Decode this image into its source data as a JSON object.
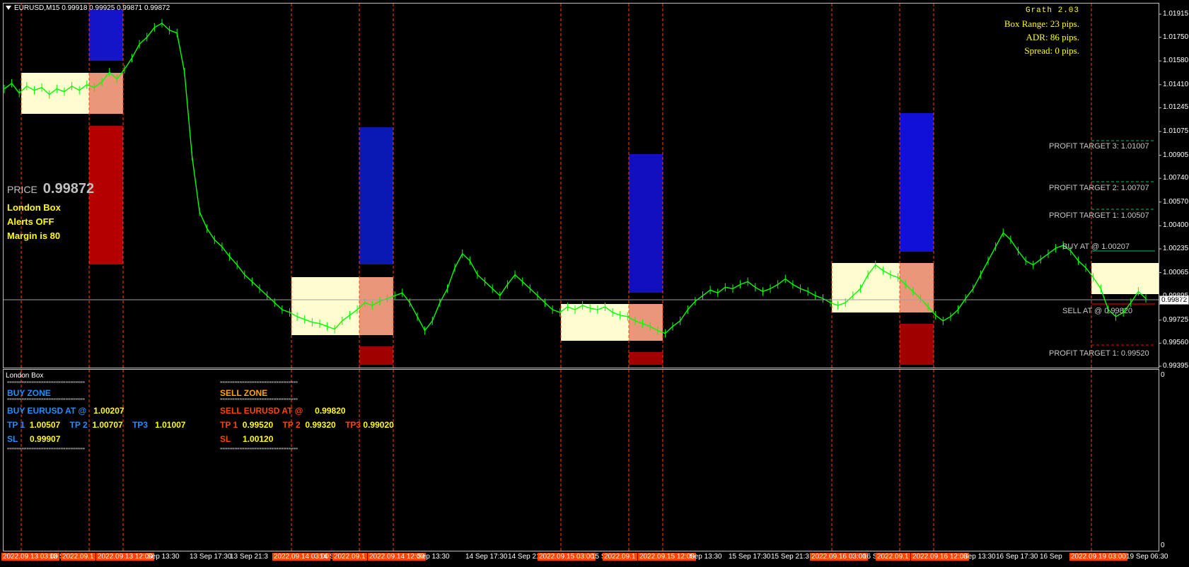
{
  "symbol_header": "EURUSD,M15  0.99918 0.99925 0.99871 0.99872",
  "info": {
    "version": "Grath 2.03",
    "box_range": "Box Range: 23 pips.",
    "adr": "ADR: 86 pips.",
    "spread": "Spread: 0 pips."
  },
  "price_label": "PRICE",
  "price_value": "0.99872",
  "status": [
    "London Box",
    "Alerts OFF",
    "Margin is 80"
  ],
  "targets": {
    "pt3": "PROFIT TARGET 3: 1.01007",
    "pt2": "PROFIT TARGET 2: 1.00707",
    "pt1": "PROFIT TARGET 1: 1.00507",
    "buy": "BUY AT @ 1.00207",
    "sell": "SELL AT @ 0.99820",
    "pt1_sell": "PROFIT TARGET 1: 0.99520"
  },
  "subwindow": {
    "title": "London Box",
    "sep": "''''''''''''''''''''''''''''''''''''''''''''''''''''''''''''''''",
    "buy": {
      "zone": "BUY ZONE",
      "at_label": "BUY EURUSD AT @",
      "at_value": "1.00207",
      "tp1_label": "TP 1",
      "tp1": "1.00507",
      "tp2_label": "TP 2",
      "tp2": "1.00707",
      "tp3_label": "TP3",
      "tp3": "1.01007",
      "sl_label": "SL",
      "sl": "0.99907"
    },
    "sell": {
      "zone": "SELL ZONE",
      "at_label": "SELL EURUSD AT @",
      "at_value": "0.99820",
      "tp1_label": "TP 1",
      "tp1": "0.99520",
      "tp2_label": "TP 2",
      "tp2": "0.99320",
      "tp3_label": "TP3",
      "tp3": "0.99020",
      "sl_label": "SL",
      "sl": "1.00120"
    },
    "axis_top": "0",
    "axis_bottom": "0"
  },
  "colors": {
    "candle": "#00ff00",
    "buy_color": "#1e90ff",
    "sell_color": "#ff4500",
    "value_color": "#ffff00",
    "box_fill": "#fffdd0",
    "salmon": "#e9967a",
    "dashed": "#ff4500"
  },
  "chart_data": {
    "type": "line",
    "title": "EURUSD,M15",
    "y_ticks": [
      "1.01915",
      "1.01750",
      "1.01580",
      "1.01410",
      "1.01245",
      "1.01075",
      "1.00905",
      "1.00740",
      "1.00570",
      "1.00400",
      "1.00235",
      "1.00065",
      "0.99895",
      "0.99725",
      "0.99560",
      "0.99395"
    ],
    "ylim": [
      0.99395,
      1.01915
    ],
    "current_price": "0.99872",
    "x_labels": [
      {
        "text": "2022.09.13 03:00",
        "hl": true
      },
      {
        "text": "13 S",
        "hl": false
      },
      {
        "text": "2022.09.1",
        "hl": true
      },
      {
        "text": "2022.09.13 12:00",
        "hl": true
      },
      {
        "text": "Sep 13:30",
        "hl": false
      },
      {
        "text": "13 Sep 17:30",
        "hl": false
      },
      {
        "text": "13 Sep 21:3",
        "hl": false
      },
      {
        "text": "2022.09.14 03:00",
        "hl": true
      },
      {
        "text": "14 S",
        "hl": false
      },
      {
        "text": "2022.09.1",
        "hl": true
      },
      {
        "text": "2022.09.14 12:00",
        "hl": true
      },
      {
        "text": "Sep 13:30",
        "hl": false
      },
      {
        "text": "14 Sep 17:30",
        "hl": false
      },
      {
        "text": "14 Sep 21:3",
        "hl": false
      },
      {
        "text": "2022.09.15 03:00",
        "hl": true
      },
      {
        "text": "15 S",
        "hl": false
      },
      {
        "text": "2022.09.1",
        "hl": true
      },
      {
        "text": "2022.09.15 12:00",
        "hl": true
      },
      {
        "text": "Sep 13:30",
        "hl": false
      },
      {
        "text": "15 Sep 17:30",
        "hl": false
      },
      {
        "text": "15 Sep 21:3",
        "hl": false
      },
      {
        "text": "2022.09.16 03:00",
        "hl": true
      },
      {
        "text": "16 S",
        "hl": false
      },
      {
        "text": "2022.09.1",
        "hl": true
      },
      {
        "text": "2022.09.16 12:00",
        "hl": true
      },
      {
        "text": "Sep 13:30",
        "hl": false
      },
      {
        "text": "16 Sep 17:30",
        "hl": false
      },
      {
        "text": "16 Sep",
        "hl": false
      },
      {
        "text": "2022.09.19 03:00",
        "hl": true
      },
      {
        "text": "19 Sep 06:30",
        "hl": false
      }
    ],
    "series": [
      {
        "values": [
          1.0138,
          1.0142,
          1.0135,
          1.014,
          1.0137,
          1.0139,
          1.0134,
          1.0138,
          1.0136,
          1.014,
          1.0137,
          1.0141,
          1.0139,
          1.0143,
          1.015,
          1.0145,
          1.0152,
          1.016,
          1.017,
          1.0175,
          1.0182,
          1.0185,
          1.018,
          1.0178,
          1.015,
          1.009,
          1.005,
          1.0038,
          1.003,
          1.0025,
          1.0018,
          1.0012,
          1.0005,
          1.0,
          0.9995,
          0.999,
          0.9985,
          0.998,
          0.9978,
          0.9975,
          0.9973,
          0.9971,
          0.997,
          0.9968,
          0.9966,
          0.9972,
          0.9976,
          0.998,
          0.9985,
          0.9983,
          0.9986,
          0.9988,
          0.999,
          0.9992,
          0.9985,
          0.9975,
          0.9965,
          0.9972,
          0.9985,
          0.9995,
          1.001,
          1.002,
          1.0015,
          1.0005,
          1.0,
          0.9995,
          0.999,
          0.9998,
          1.0005,
          1.0,
          0.9995,
          0.999,
          0.9985,
          0.998,
          0.9978,
          0.9982,
          0.998,
          0.9983,
          0.9981,
          0.998,
          0.9982,
          0.9978,
          0.9976,
          0.9975,
          0.9972,
          0.997,
          0.9968,
          0.9965,
          0.9963,
          0.9968,
          0.9972,
          0.998,
          0.9986,
          0.999,
          0.9994,
          0.9992,
          0.9996,
          0.9995,
          0.9998,
          1.0,
          0.9996,
          0.9993,
          0.9995,
          0.9998,
          1.0002,
          0.9998,
          0.9995,
          0.9993,
          0.999,
          0.9988,
          0.9985,
          0.9983,
          0.9985,
          0.999,
          0.9995,
          1.0005,
          1.0012,
          1.0008,
          1.0005,
          1.0003,
          0.9998,
          0.9993,
          0.9988,
          0.9982,
          0.9976,
          0.9972,
          0.9975,
          0.998,
          0.9988,
          0.9995,
          1.0005,
          1.0015,
          1.0025,
          1.0035,
          1.003,
          1.0022,
          1.0015,
          1.0012,
          1.0016,
          1.002,
          1.0024,
          1.0026,
          1.0022,
          1.0015,
          1.001,
          1.0003,
          0.9995,
          0.998,
          0.9975,
          0.9978,
          0.9985,
          0.9993,
          0.9988
        ]
      }
    ]
  }
}
